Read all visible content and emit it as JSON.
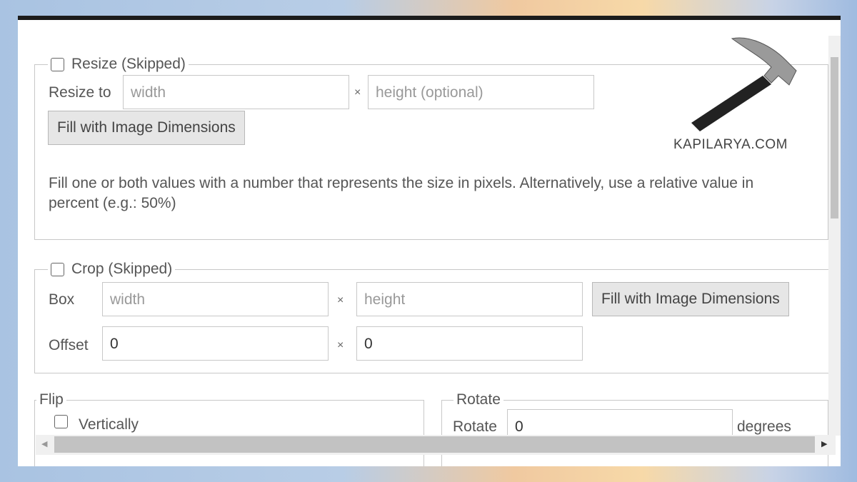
{
  "watermark": "KAPILARYA.COM",
  "resize": {
    "legend": "Resize (Skipped)",
    "checked": false,
    "label": "Resize to",
    "width_placeholder": "width",
    "sep": "×",
    "height_placeholder": "height (optional)",
    "fill_button": "Fill with Image Dimensions",
    "help": "Fill one or both values with a number that represents the size in pixels. Alternatively, use a relative value in percent (e.g.: 50%)"
  },
  "crop": {
    "legend": "Crop (Skipped)",
    "checked": false,
    "box_label": "Box",
    "width_placeholder": "width",
    "sep": "×",
    "height_placeholder": "height",
    "fill_button": "Fill with Image Dimensions",
    "offset_label": "Offset",
    "offset_x": "0",
    "offset_y": "0"
  },
  "flip": {
    "legend": "Flip",
    "vertically": "Vertically",
    "checked": false
  },
  "rotate": {
    "legend": "Rotate",
    "label": "Rotate",
    "value": "0",
    "unit": "degrees"
  }
}
